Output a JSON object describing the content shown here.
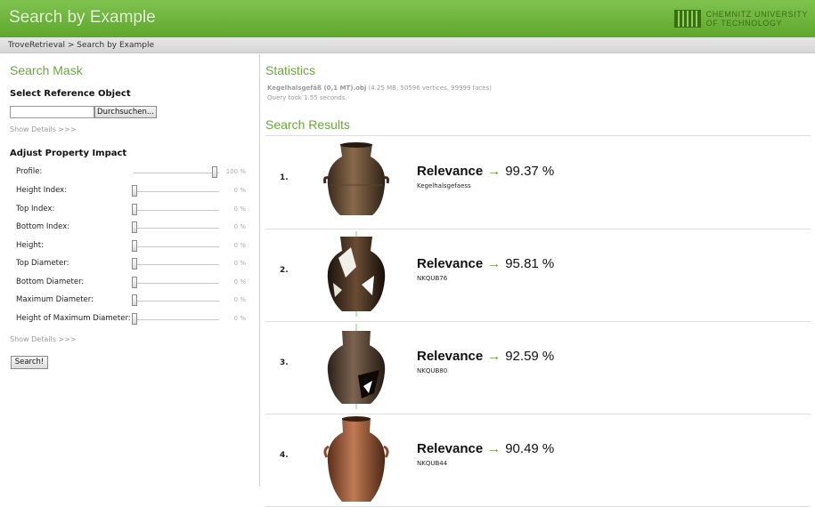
{
  "header": {
    "title": "Search by Example",
    "logo_line1": "CHEMNITZ UNIVERSITY",
    "logo_line2": "OF TECHNOLOGY"
  },
  "breadcrumb": "TroveRetrieval > Search by Example",
  "search_mask": {
    "title": "Search Mask",
    "reference_label": "Select Reference Object",
    "file_value": "",
    "browse_label": "Durchsuchen...",
    "show_details_1": "Show Details >>>",
    "property_label": "Adjust Property Impact",
    "sliders": [
      {
        "label": "Profile:",
        "value": "100 %",
        "level": 100
      },
      {
        "label": "Height Index:",
        "value": "0 %",
        "level": 0
      },
      {
        "label": "Top Index:",
        "value": "0 %",
        "level": 0
      },
      {
        "label": "Bottom Index:",
        "value": "0 %",
        "level": 0
      },
      {
        "label": "Height:",
        "value": "0 %",
        "level": 0
      },
      {
        "label": "Top Diameter:",
        "value": "0 %",
        "level": 0
      },
      {
        "label": "Bottom Diameter:",
        "value": "0 %",
        "level": 0
      },
      {
        "label": "Maximum Diameter:",
        "value": "0 %",
        "level": 0
      },
      {
        "label": "Height of Maximum Diameter:",
        "value": "0 %",
        "level": 0
      }
    ],
    "show_details_2": "Show Details >>>",
    "search_label": "Search!"
  },
  "statistics": {
    "title": "Statistics",
    "file_name": "Kegelhalsgefäß (0,1 MT).obj",
    "file_info": "(4.25 MB, 50596 vertices, 99999 faces)",
    "query_time": "Query took 1.55 seconds."
  },
  "results": {
    "title": "Search Results",
    "relevance_label": "Relevance",
    "items": [
      {
        "rank": "1.",
        "score": "99.37 %",
        "name": "Kegelhalsgefaess"
      },
      {
        "rank": "2.",
        "score": "95.81 %",
        "name": "NKQUB76"
      },
      {
        "rank": "3.",
        "score": "92.59 %",
        "name": "NKQUB80"
      },
      {
        "rank": "4.",
        "score": "90.49 %",
        "name": "NKQUB44"
      }
    ]
  },
  "colors": {
    "header_green": "#6fb43e",
    "accent_green": "#6aa83a"
  }
}
